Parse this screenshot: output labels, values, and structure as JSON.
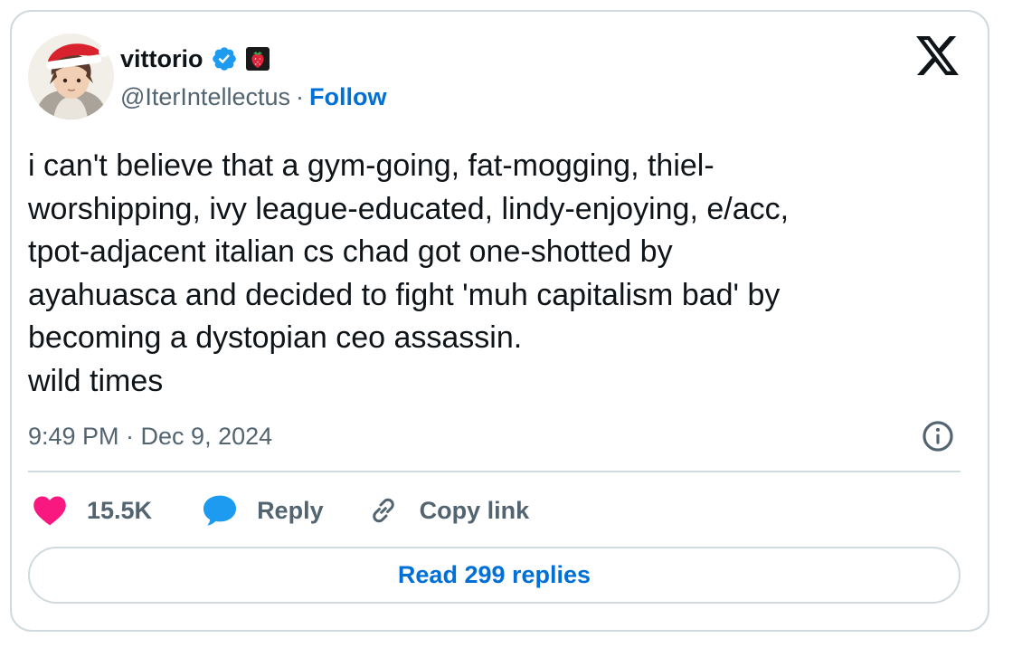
{
  "author": {
    "display_name": "vittorio",
    "handle": "@IterIntellectus",
    "separator": "·",
    "follow_label": "Follow",
    "verified_color": "#1d9bf0",
    "avatar_icon": "anime-character-santa-hat-avatar",
    "badge_icon": "strawberry-badge-icon"
  },
  "brand": {
    "logo_icon": "x-logo-icon"
  },
  "tweet": {
    "lines": [
      "i can't believe that a gym-going, fat-mogging, thiel-",
      "worshipping, ivy league-educated, lindy-enjoying, e/acc,",
      "tpot-adjacent italian cs chad got one-shotted by",
      "ayahuasca and decided to fight 'muh capitalism bad' by",
      "becoming a dystopian ceo assassin.",
      "wild times"
    ],
    "timestamp": "9:49 PM · Dec 9, 2024"
  },
  "actions": {
    "like_count": "15.5K",
    "reply_label": "Reply",
    "copy_label": "Copy link",
    "like_color": "#f91880",
    "reply_color": "#1d9bf0"
  },
  "footer": {
    "read_replies_label": "Read 299 replies"
  }
}
